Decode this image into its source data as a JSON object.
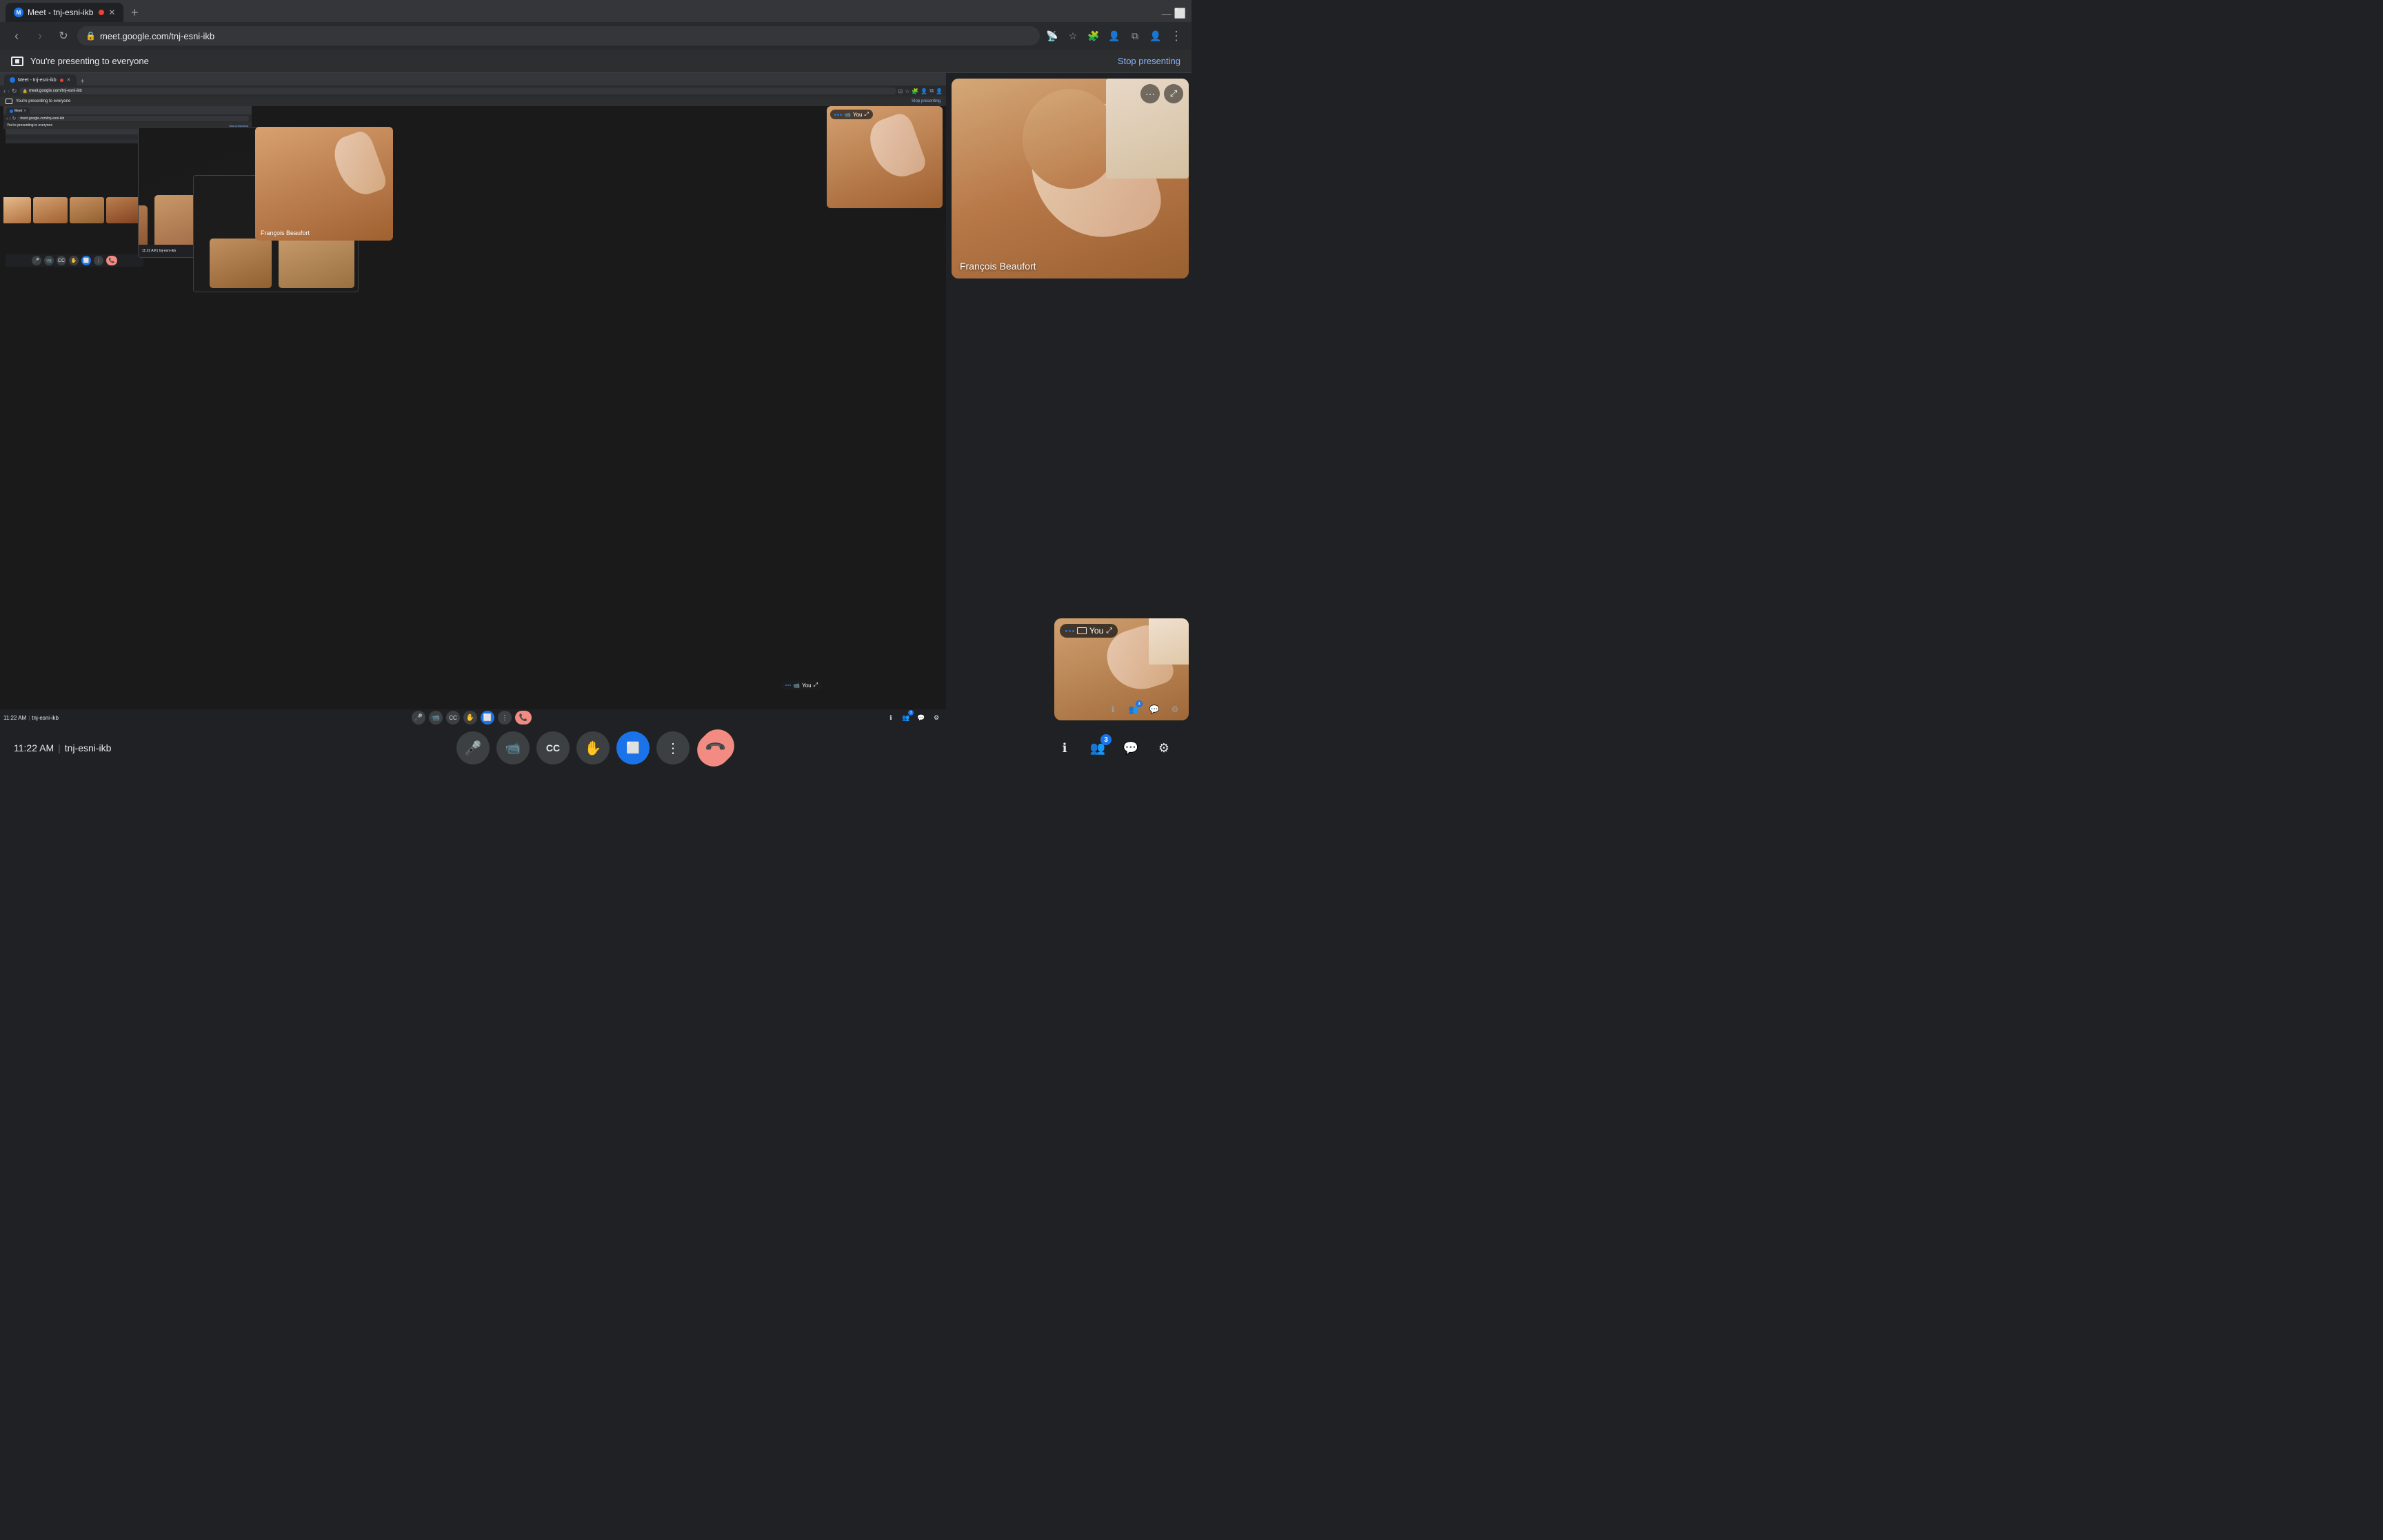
{
  "browser": {
    "tab_title": "Meet - tnj-esni-ikb",
    "tab_favicon": "M",
    "new_tab_label": "+",
    "address": "meet.google.com/tnj-esni-ikb",
    "nav_back": "←",
    "nav_forward": "→",
    "nav_refresh": "↻",
    "tab_close": "✕",
    "more_options": "⋮"
  },
  "presenting_banner": {
    "icon": "⬜",
    "text": "You're presenting to everyone",
    "stop_btn": "Stop presenting"
  },
  "toolbar": {
    "time": "11:22 AM",
    "separator": "|",
    "meeting_id": "tnj-esni-ikb",
    "mic_icon": "🎤",
    "camera_icon": "📹",
    "captions_icon": "CC",
    "raise_hand_icon": "✋",
    "present_icon": "⬜",
    "more_icon": "⋮",
    "end_icon": "📞",
    "info_icon": "ℹ",
    "people_icon": "👥",
    "chat_icon": "💬",
    "activities_icon": "⚙",
    "people_badge": "3"
  },
  "participants": {
    "francois": {
      "name": "François Beaufort",
      "name_short": "François Beaufort"
    },
    "you": {
      "label": "You"
    }
  },
  "inner_banner": {
    "text": "You're presenting to everyone",
    "stop": "Stop presenting"
  }
}
